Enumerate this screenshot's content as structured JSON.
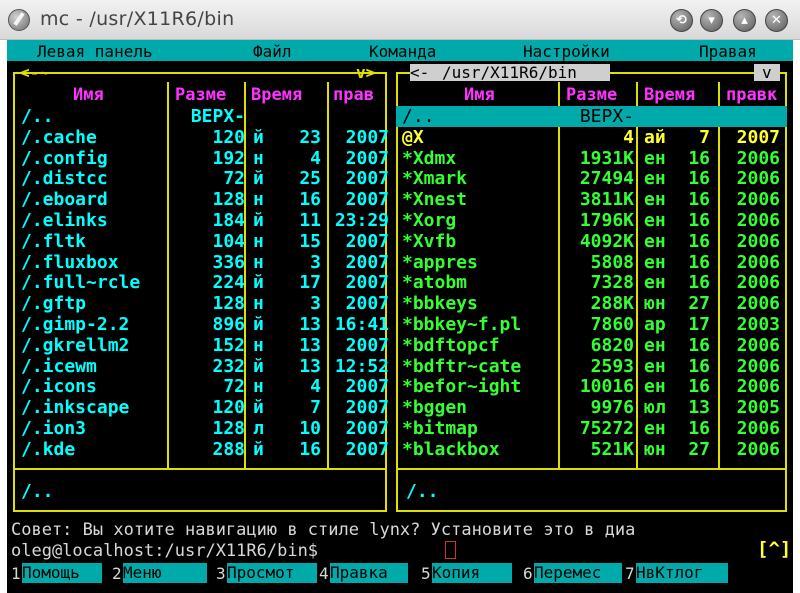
{
  "window": {
    "title": "mc - /usr/X11R6/bin",
    "buttons": [
      "⟲",
      "▾",
      "▴",
      "✕"
    ]
  },
  "menu": {
    "items": [
      "Левая панель",
      "Файл",
      "Команда",
      "Настройки",
      "Правая"
    ]
  },
  "left_panel": {
    "top_path": "<-~",
    "top_arrow": "v>",
    "headers": {
      "name": "Имя",
      "size": "Разме",
      "time": "Время",
      "perm": "прав"
    },
    "rows": [
      {
        "name": "/..",
        "size": "ВЕРХ-",
        "mon": "",
        "day": "",
        "year": ""
      },
      {
        "name": "/.cache",
        "size": "120",
        "mon": "й",
        "day": "23",
        "year": "2007"
      },
      {
        "name": "/.config",
        "size": "192",
        "mon": "н",
        "day": "4",
        "year": "2007"
      },
      {
        "name": "/.distcc",
        "size": "72",
        "mon": "й",
        "day": "25",
        "year": "2007"
      },
      {
        "name": "/.eboard",
        "size": "128",
        "mon": "н",
        "day": "16",
        "year": "2007"
      },
      {
        "name": "/.elinks",
        "size": "184",
        "mon": "й",
        "day": "11",
        "year": "23:29"
      },
      {
        "name": "/.fltk",
        "size": "104",
        "mon": "н",
        "day": "15",
        "year": "2007"
      },
      {
        "name": "/.fluxbox",
        "size": "336",
        "mon": "н",
        "day": "3",
        "year": "2007"
      },
      {
        "name": "/.full~rcle",
        "size": "224",
        "mon": "й",
        "day": "17",
        "year": "2007"
      },
      {
        "name": "/.gftp",
        "size": "128",
        "mon": "н",
        "day": "3",
        "year": "2007"
      },
      {
        "name": "/.gimp-2.2",
        "size": "896",
        "mon": "й",
        "day": "13",
        "year": "16:41"
      },
      {
        "name": "/.gkrellm2",
        "size": "152",
        "mon": "н",
        "day": "13",
        "year": "2007"
      },
      {
        "name": "/.icewm",
        "size": "232",
        "mon": "й",
        "day": "13",
        "year": "12:52"
      },
      {
        "name": "/.icons",
        "size": "72",
        "mon": "н",
        "day": "4",
        "year": "2007"
      },
      {
        "name": "/.inkscape",
        "size": "120",
        "mon": "й",
        "day": "7",
        "year": "2007"
      },
      {
        "name": "/.ion3",
        "size": "128",
        "mon": "л",
        "day": "10",
        "year": "2007"
      },
      {
        "name": "/.kde",
        "size": "288",
        "mon": "й",
        "day": "16",
        "year": "2007"
      }
    ],
    "mini_status": "/.."
  },
  "right_panel": {
    "top_path": "/usr/X11R6/bin",
    "top_left": "<-",
    "top_arrow": "v",
    "headers": {
      "name": "Имя",
      "size": "Разме",
      "time": "Время",
      "perm": "правк"
    },
    "rows": [
      {
        "name": "/..",
        "size": "ВЕРХ-",
        "mon": "",
        "day": "",
        "year": "",
        "kind": "selected"
      },
      {
        "name": "@X",
        "size": "4",
        "mon": "ай",
        "day": "7",
        "year": "2007",
        "kind": "link"
      },
      {
        "name": "*Xdmx",
        "size": "1931K",
        "mon": "ен",
        "day": "16",
        "year": "2006",
        "kind": "exec"
      },
      {
        "name": "*Xmark",
        "size": "27494",
        "mon": "ен",
        "day": "16",
        "year": "2006",
        "kind": "exec"
      },
      {
        "name": "*Xnest",
        "size": "3811K",
        "mon": "ен",
        "day": "16",
        "year": "2006",
        "kind": "exec"
      },
      {
        "name": "*Xorg",
        "size": "1796K",
        "mon": "ен",
        "day": "16",
        "year": "2006",
        "kind": "exec"
      },
      {
        "name": "*Xvfb",
        "size": "4092K",
        "mon": "ен",
        "day": "16",
        "year": "2006",
        "kind": "exec"
      },
      {
        "name": "*appres",
        "size": "5808",
        "mon": "ен",
        "day": "16",
        "year": "2006",
        "kind": "exec"
      },
      {
        "name": "*atobm",
        "size": "7328",
        "mon": "ен",
        "day": "16",
        "year": "2006",
        "kind": "exec"
      },
      {
        "name": "*bbkeys",
        "size": "288K",
        "mon": "юн",
        "day": "27",
        "year": "2006",
        "kind": "exec"
      },
      {
        "name": "*bbkey~f.pl",
        "size": "7860",
        "mon": "ар",
        "day": "17",
        "year": "2003",
        "kind": "exec"
      },
      {
        "name": "*bdftopcf",
        "size": "6820",
        "mon": "ен",
        "day": "16",
        "year": "2006",
        "kind": "exec"
      },
      {
        "name": "*bdftr~cate",
        "size": "2593",
        "mon": "ен",
        "day": "16",
        "year": "2006",
        "kind": "exec"
      },
      {
        "name": "*befor~ight",
        "size": "10016",
        "mon": "ен",
        "day": "16",
        "year": "2006",
        "kind": "exec"
      },
      {
        "name": "*bggen",
        "size": "9976",
        "mon": "юл",
        "day": "13",
        "year": "2005",
        "kind": "exec"
      },
      {
        "name": "*bitmap",
        "size": "75272",
        "mon": "ен",
        "day": "16",
        "year": "2006",
        "kind": "exec"
      },
      {
        "name": "*blackbox",
        "size": "521K",
        "mon": "юн",
        "day": "27",
        "year": "2006",
        "kind": "exec"
      }
    ],
    "mini_status": "/.."
  },
  "hint": "Совет: Вы хотите навигацию в стиле lynx? Установите это в диа",
  "prompt": "oleg@localhost:/usr/X11R6/bin$",
  "prompt_bracket": "[^]",
  "fkeys": [
    {
      "num": "1",
      "label": "Помощь"
    },
    {
      "num": "2",
      "label": "Меню"
    },
    {
      "num": "3",
      "label": "Просмот"
    },
    {
      "num": "4",
      "label": "Правка"
    },
    {
      "num": "5",
      "label": "Копия"
    },
    {
      "num": "6",
      "label": "Перемес"
    },
    {
      "num": "7",
      "label": "НвКтлог"
    }
  ],
  "colors": {
    "terminal_bg": "#000000",
    "menu_bg": "#00aaaa",
    "frame": "#e0e000",
    "header": "#ff33ff",
    "entry": "#00ffff",
    "exec": "#33ff33",
    "link": "#ffff33",
    "selected_bg": "#00aaaa"
  }
}
